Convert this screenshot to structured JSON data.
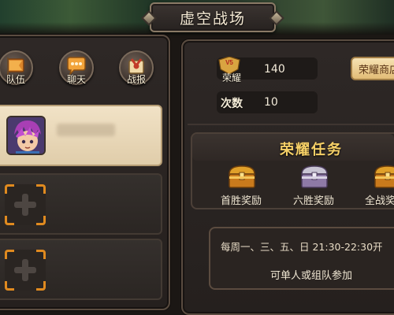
{
  "title": "虚空战场",
  "left_nav": [
    {
      "label": "队伍",
      "icon": "team-flag-icon"
    },
    {
      "label": "聊天",
      "icon": "chat-bubble-icon"
    },
    {
      "label": "战报",
      "icon": "battle-report-icon"
    }
  ],
  "team_slots": [
    {
      "state": "filled",
      "icon": "player-avatar"
    },
    {
      "state": "empty",
      "icon": "add-plus-icon"
    },
    {
      "state": "empty",
      "icon": "add-plus-icon"
    }
  ],
  "stats": {
    "honor_badge": "V5",
    "honor_label": "荣耀",
    "honor_value": "140",
    "wins_label": "次数",
    "wins_value": "10"
  },
  "shop_button": "荣耀商店",
  "tasks": {
    "title": "荣耀任务",
    "rewards": [
      {
        "label": "首胜奖励",
        "icon": "gold-chest-icon"
      },
      {
        "label": "六胜奖励",
        "icon": "silver-chest-icon"
      },
      {
        "label": "全战奖",
        "icon": "gold-chest-icon"
      }
    ]
  },
  "schedule": {
    "days": "每周一、三、五、日 21:30-22:30开",
    "note": "可单人或组队参加"
  },
  "colors": {
    "panel_bg": "#2e2826",
    "panel_border": "#5a4c40",
    "title_gold": "#f6d067",
    "accent_orange": "#e08a1f",
    "shop_button_bg": "#e2bc76"
  }
}
